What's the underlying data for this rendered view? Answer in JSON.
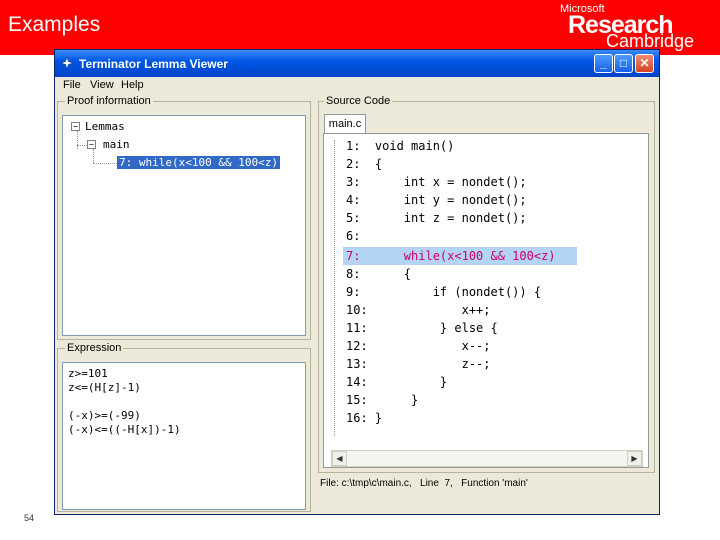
{
  "slide": {
    "title": "Examples",
    "number": "54",
    "logo": {
      "line1": "Microsoft",
      "line2": "Research",
      "line3": "Cambridge"
    }
  },
  "window": {
    "title": "Terminator Lemma Viewer",
    "menu": [
      "File",
      "View",
      "Help"
    ],
    "controls": {
      "minimize": "_",
      "maximize": "□",
      "close": "✕"
    }
  },
  "proof": {
    "label": "Proof information",
    "tree": [
      {
        "text": "Lemmas",
        "expander": "−"
      },
      {
        "text": "main",
        "expander": "−"
      },
      {
        "text": "7: while(x<100 && 100<z)",
        "selected": true
      }
    ]
  },
  "expression": {
    "label": "Expression",
    "lines": [
      "z>=101",
      "z<=(H[z]-1)",
      "",
      "(-x)>=(-99)",
      "(-x)<=((-H[x])-1)"
    ]
  },
  "source": {
    "label": "Source Code",
    "tab": "main.c",
    "highlight_line": 7,
    "lines": [
      "1:  void main()",
      "2:  {",
      "3:      int x = nondet();",
      "4:      int y = nondet();",
      "5:      int z = nondet();",
      "6:",
      "7:      while(x<100 && 100<z)",
      "8:      {",
      "9:          if (nondet()) {",
      "10:             x++;",
      "11:          } else {",
      "12:             x--;",
      "13:             z--;",
      "14:          }",
      "15:      }",
      "16: }"
    ]
  },
  "status": "File: c:\\tmp\\c\\main.c,   Line  7,   Function 'main'",
  "colors": {
    "slide_red": "#ff0000",
    "highlight_text": "#cc0066",
    "selection": "#3169c6"
  }
}
